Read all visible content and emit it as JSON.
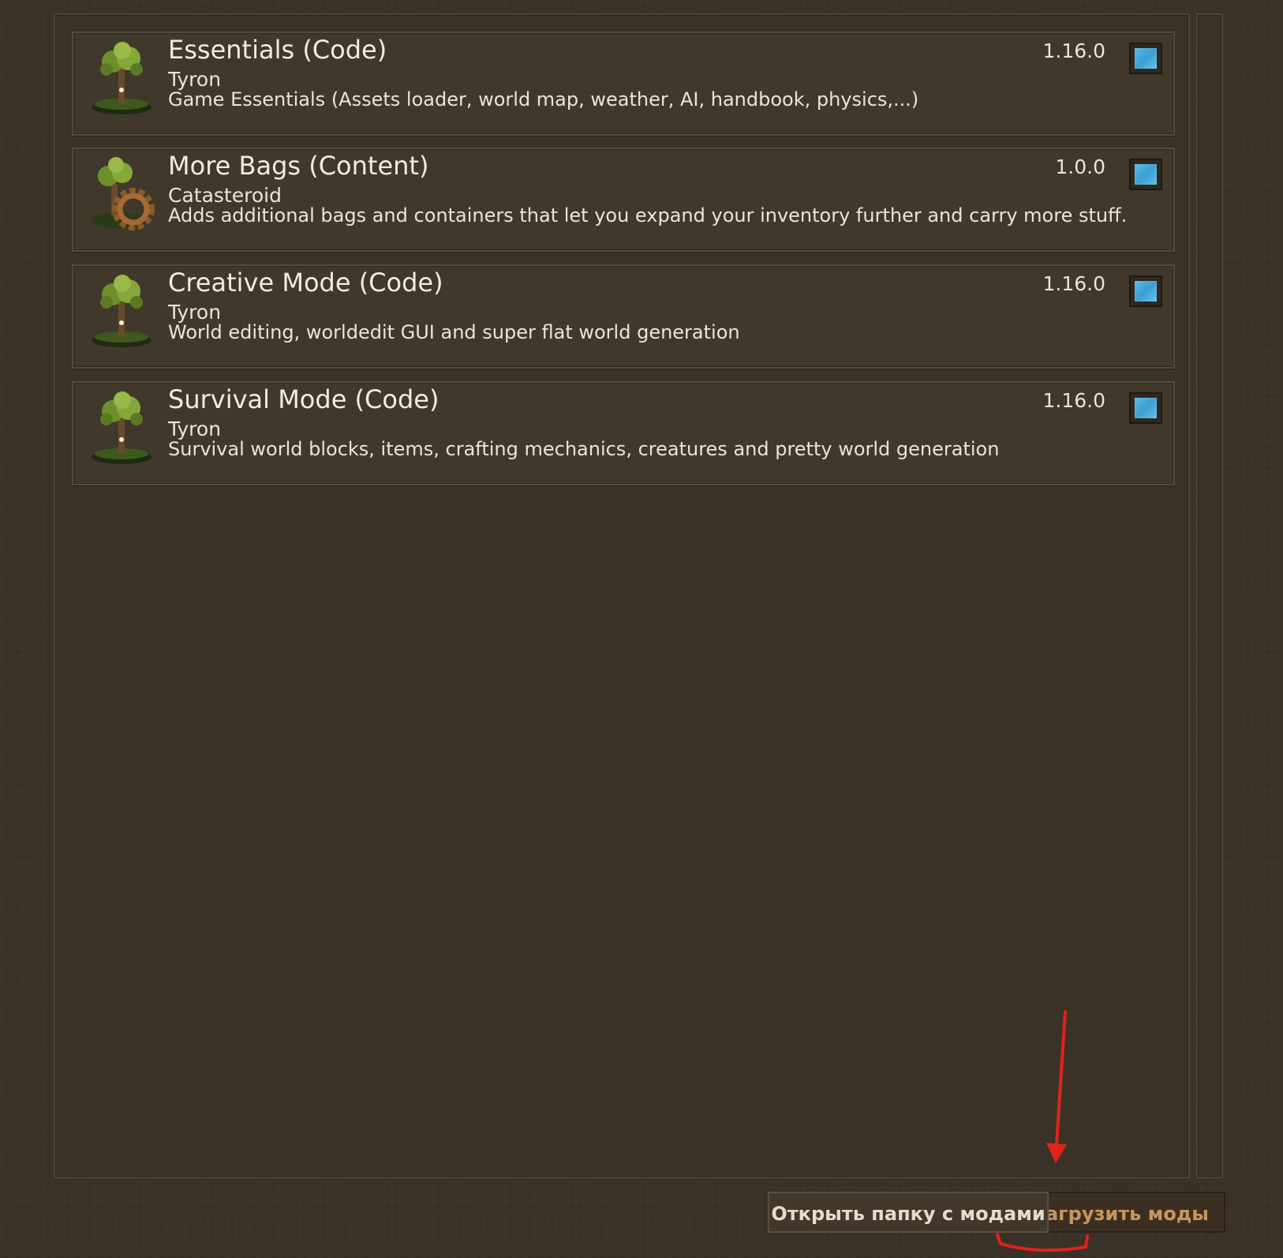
{
  "mods": [
    {
      "title": "Essentials (Code)",
      "author": "Tyron",
      "description": "Game Essentials (Assets loader, world map, weather, AI, handbook, physics,...)",
      "version": "1.16.0",
      "icon": "vintage-story-tree-icon",
      "enabled": true
    },
    {
      "title": "More Bags (Content)",
      "author": "Catasteroid",
      "description": "Adds additional bags and containers that let you expand your inventory further and carry more stuff.",
      "version": "1.0.0",
      "icon": "tree-gear-icon",
      "enabled": true
    },
    {
      "title": "Creative Mode (Code)",
      "author": "Tyron",
      "description": "World editing, worldedit GUI and super flat world generation",
      "version": "1.16.0",
      "icon": "vintage-story-tree-icon",
      "enabled": true
    },
    {
      "title": "Survival Mode (Code)",
      "author": "Tyron",
      "description": "Survival world blocks, items, crafting mechanics, creatures and pretty world generation",
      "version": "1.16.0",
      "icon": "vintage-story-tree-icon",
      "enabled": true
    }
  ],
  "buttons": {
    "open_folder": "Открыть папку с модами",
    "reload_visible": "загрузить моды"
  },
  "colors": {
    "background": "#3a3128",
    "toggle_on": "#4aaee0",
    "annotation": "#e0231b",
    "reload_text": "#c6975c"
  }
}
